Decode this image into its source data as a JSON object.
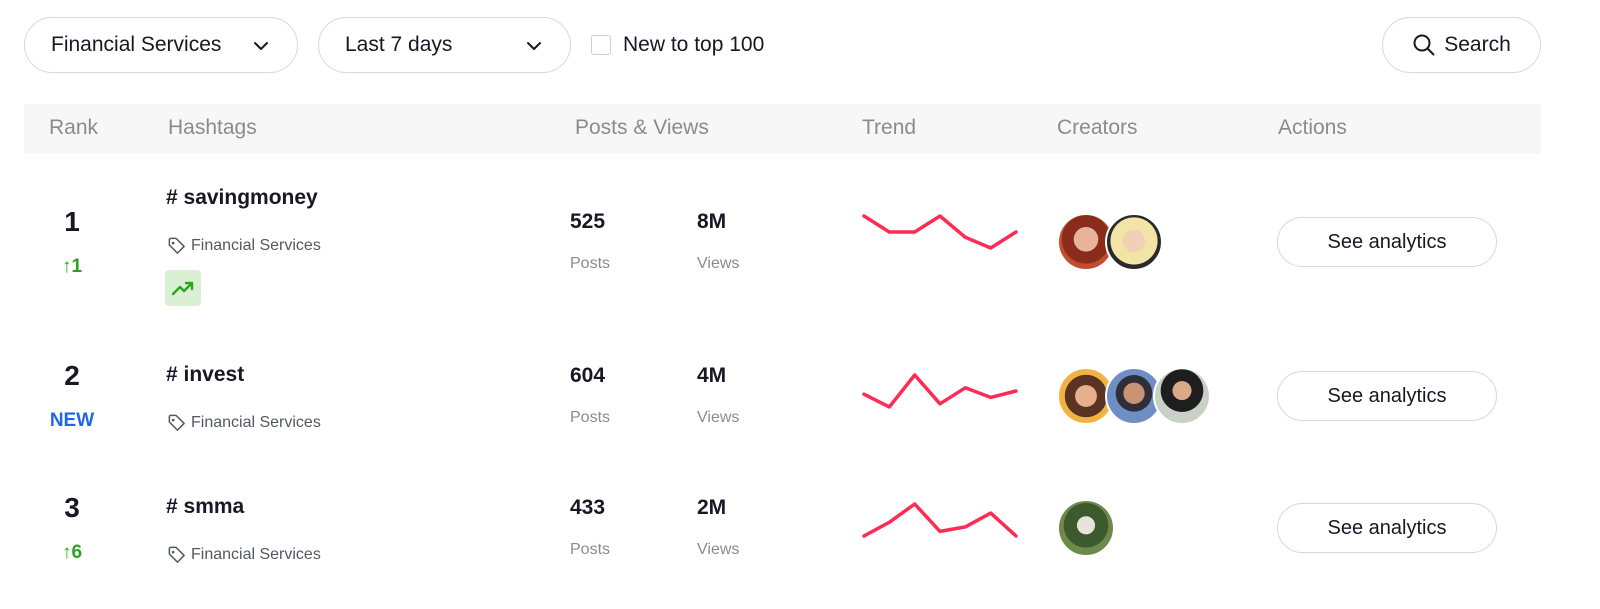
{
  "filters": {
    "industry": "Financial Services",
    "period": "Last 7 days",
    "new_to_top_label": "New to top 100",
    "new_to_top_checked": false,
    "search_label": "Search"
  },
  "table": {
    "columns": [
      "Rank",
      "Hashtags",
      "Posts & Views",
      "Trend",
      "Creators",
      "Actions"
    ],
    "rows": [
      {
        "rank": "1",
        "change": "1",
        "change_type": "up",
        "hashtag": "# savingmoney",
        "industry": "Financial Services",
        "trending_badge": true,
        "posts": "525",
        "posts_label": "Posts",
        "views": "8M",
        "views_label": "Views",
        "trend": [
          6,
          3,
          3,
          6,
          2,
          0,
          3
        ],
        "creators": [
          "creator-avatar-1",
          "creator-avatar-2"
        ],
        "action": "See analytics"
      },
      {
        "rank": "2",
        "change": "NEW",
        "change_type": "new",
        "hashtag": "# invest",
        "industry": "Financial Services",
        "trending_badge": false,
        "posts": "604",
        "posts_label": "Posts",
        "views": "4M",
        "views_label": "Views",
        "trend": [
          4,
          0,
          10,
          1,
          6,
          3,
          5
        ],
        "creators": [
          "creator-avatar-3",
          "creator-avatar-4",
          "creator-avatar-5"
        ],
        "action": "See analytics"
      },
      {
        "rank": "3",
        "change": "6",
        "change_type": "up",
        "hashtag": "# smma",
        "industry": "Financial Services",
        "trending_badge": false,
        "posts": "433",
        "posts_label": "Posts",
        "views": "2M",
        "views_label": "Views",
        "trend": [
          2,
          5,
          9,
          3,
          4,
          7,
          2
        ],
        "creators": [
          "creator-avatar-6"
        ],
        "action": "See analytics"
      }
    ]
  },
  "colors": {
    "trend_line": "#fe2c55",
    "up": "#2ea121",
    "new": "#1e68e8"
  }
}
